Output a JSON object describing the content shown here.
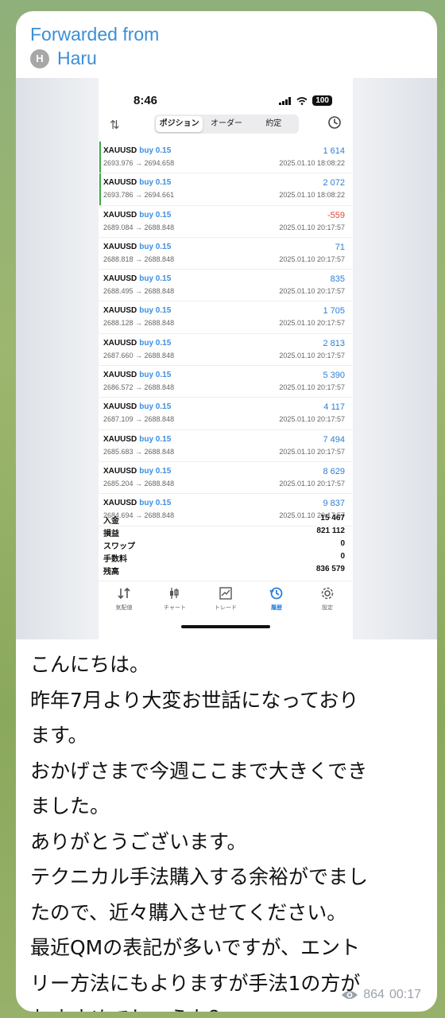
{
  "forward": {
    "title": "Forwarded from",
    "avatar_letter": "H",
    "name": "Haru"
  },
  "phone": {
    "time": "8:46",
    "battery": "100",
    "tabs": [
      "ポジション",
      "オーダー",
      "約定"
    ],
    "rows": [
      {
        "symbol": "XAUUSD",
        "side": "buy 0.15",
        "prices": "2693.976 → 2694.658",
        "profit": "1 614",
        "date": "2025.01.10 18:08:22",
        "neg": false,
        "marker": true
      },
      {
        "symbol": "XAUUSD",
        "side": "buy 0.15",
        "prices": "2693.786 → 2694.661",
        "profit": "2 072",
        "date": "2025.01.10 18:08:22",
        "neg": false,
        "marker": true
      },
      {
        "symbol": "XAUUSD",
        "side": "buy 0.15",
        "prices": "2689.084 → 2688.848",
        "profit": "-559",
        "date": "2025.01.10 20:17:57",
        "neg": true,
        "marker": false
      },
      {
        "symbol": "XAUUSD",
        "side": "buy 0.15",
        "prices": "2688.818 → 2688.848",
        "profit": "71",
        "date": "2025.01.10 20:17:57",
        "neg": false,
        "marker": false
      },
      {
        "symbol": "XAUUSD",
        "side": "buy 0.15",
        "prices": "2688.495 → 2688.848",
        "profit": "835",
        "date": "2025.01.10 20:17:57",
        "neg": false,
        "marker": false
      },
      {
        "symbol": "XAUUSD",
        "side": "buy 0.15",
        "prices": "2688.128 → 2688.848",
        "profit": "1 705",
        "date": "2025.01.10 20:17:57",
        "neg": false,
        "marker": false
      },
      {
        "symbol": "XAUUSD",
        "side": "buy 0.15",
        "prices": "2687.660 → 2688.848",
        "profit": "2 813",
        "date": "2025.01.10 20:17:57",
        "neg": false,
        "marker": false
      },
      {
        "symbol": "XAUUSD",
        "side": "buy 0.15",
        "prices": "2686.572 → 2688.848",
        "profit": "5 390",
        "date": "2025.01.10 20:17:57",
        "neg": false,
        "marker": false
      },
      {
        "symbol": "XAUUSD",
        "side": "buy 0.15",
        "prices": "2687.109 → 2688.848",
        "profit": "4 117",
        "date": "2025.01.10 20:17:57",
        "neg": false,
        "marker": false
      },
      {
        "symbol": "XAUUSD",
        "side": "buy 0.15",
        "prices": "2685.683 → 2688.848",
        "profit": "7 494",
        "date": "2025.01.10 20:17:57",
        "neg": false,
        "marker": false
      },
      {
        "symbol": "XAUUSD",
        "side": "buy 0.15",
        "prices": "2685.204 → 2688.848",
        "profit": "8 629",
        "date": "2025.01.10 20:17:57",
        "neg": false,
        "marker": false
      },
      {
        "symbol": "XAUUSD",
        "side": "buy 0.15",
        "prices": "2684.694 → 2688.848",
        "profit": "9 837",
        "date": "2025.01.10 20:17:57",
        "neg": false,
        "marker": false
      }
    ],
    "summary": [
      {
        "label": "入金",
        "value": "15 467"
      },
      {
        "label": "損益",
        "value": "821 112"
      },
      {
        "label": "スワップ",
        "value": "0"
      },
      {
        "label": "手数料",
        "value": "0"
      },
      {
        "label": "残高",
        "value": "836 579"
      }
    ],
    "bottom_tabs": [
      {
        "label": "気配値",
        "icon": "quotes-icon",
        "active": false
      },
      {
        "label": "チャート",
        "icon": "chart-icon",
        "active": false
      },
      {
        "label": "トレード",
        "icon": "trade-icon",
        "active": false
      },
      {
        "label": "履歴",
        "icon": "history-icon",
        "active": true
      },
      {
        "label": "設定",
        "icon": "settings-icon",
        "active": false
      }
    ],
    "colors": {
      "profit": "#2c7ed6",
      "loss": "#e0453a",
      "marker": "#3aa64a"
    }
  },
  "message": {
    "lines": [
      "こんにちは。",
      "昨年7月より大変お世話になっており",
      "ます。",
      "おかげさまで今週ここまで大きくでき",
      "ました。",
      "ありがとうございます。",
      "テクニカル手法購入する余裕がでまし",
      "たので、近々購入させてください。",
      "最近QMの表記が多いですが、エント",
      "リー方法にもよりますが手法1の方が",
      "おすすめでしょうか？"
    ],
    "views": "864",
    "time": "00:17"
  }
}
